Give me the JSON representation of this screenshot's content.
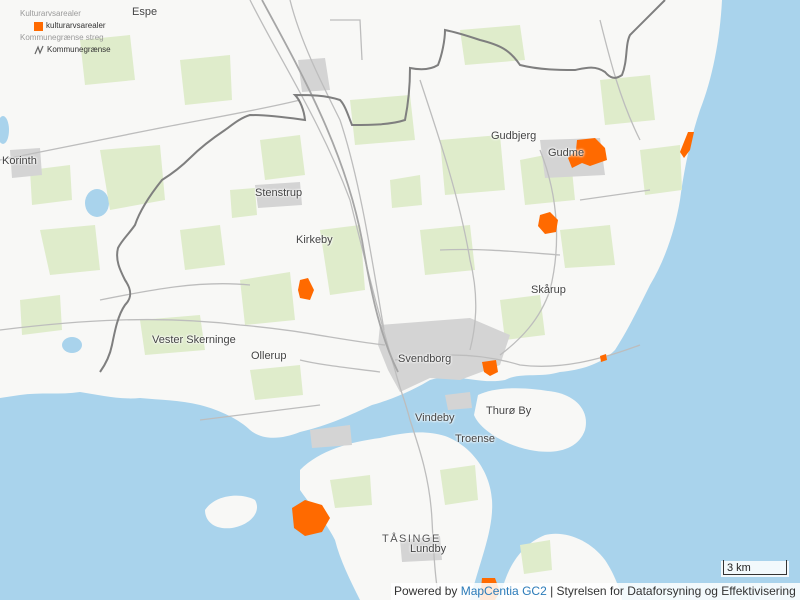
{
  "colors": {
    "water": "#a9d3ec",
    "land": "#f8f8f6",
    "field": "#dfeccb",
    "urban": "#d4d4d4",
    "road": "#bdbdbd",
    "border": "#7f7f7f",
    "heritage": "#ff6a00"
  },
  "legend": {
    "group1_title": "Kulturarvsarealer",
    "item1_label": "kulturarvsarealer",
    "group2_title": "Kommunegrænse streg",
    "item2_label": "Kommunegrænse"
  },
  "places": {
    "espe": "Espe",
    "korinth": "Korinth",
    "stenstrup": "Stenstrup",
    "kirkeby": "Kirkeby",
    "vester_skerninge": "Vester Skerninge",
    "ollerup": "Ollerup",
    "svendborg": "Svendborg",
    "gudbjerg": "Gudbjerg",
    "gudme": "Gudme",
    "skarup": "Skårup",
    "thuro_by": "Thurø By",
    "vindeby": "Vindeby",
    "troense": "Troense",
    "tasinge": "TÅSINGE",
    "lundby": "Lundby"
  },
  "scale": {
    "label": "3 km"
  },
  "attribution": {
    "prefix": "Powered by ",
    "link": "MapCentia GC2",
    "suffix": " | Styrelsen for Dataforsyning og Effektivisering"
  }
}
